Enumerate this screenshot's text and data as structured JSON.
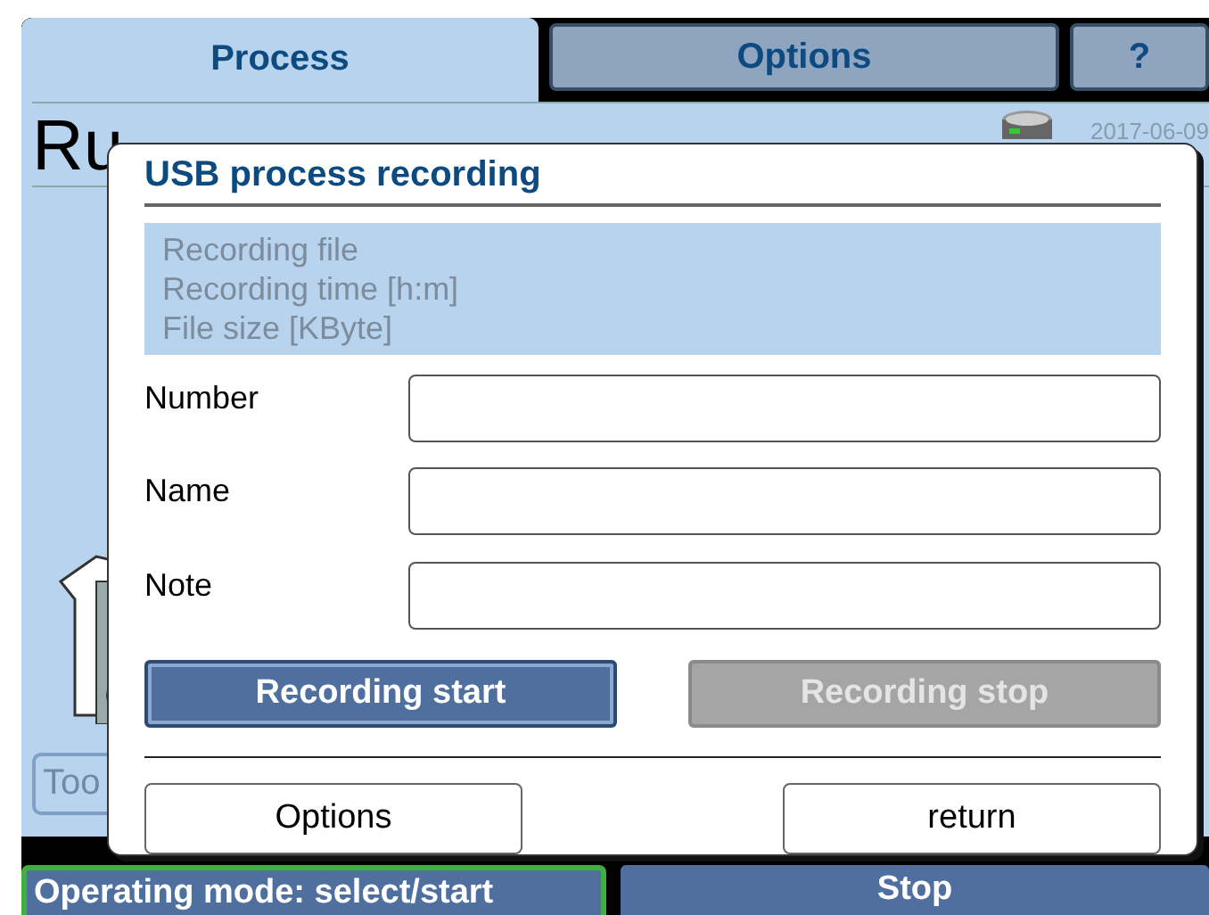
{
  "tabs": [
    {
      "label": "Process",
      "selected": true
    },
    {
      "label": "Options",
      "selected": false
    },
    {
      "label": "?",
      "selected": false
    }
  ],
  "main": {
    "title": "Ru",
    "date": "2017-06-09",
    "tool_button": "Too"
  },
  "status_bar": {
    "mode": "Operating mode: select/start",
    "stop": "Stop"
  },
  "dialog": {
    "title": "USB process recording",
    "info_lines": [
      "Recording file",
      "Recording time [h:m]",
      "File size [KByte]"
    ],
    "fields": [
      {
        "label": "Number"
      },
      {
        "label": "Name"
      },
      {
        "label": "Note"
      }
    ],
    "actions": [
      {
        "label": "Recording start",
        "disabled": false
      },
      {
        "label": "Recording stop",
        "disabled": true
      }
    ],
    "buttons": [
      "Options",
      "return"
    ]
  }
}
